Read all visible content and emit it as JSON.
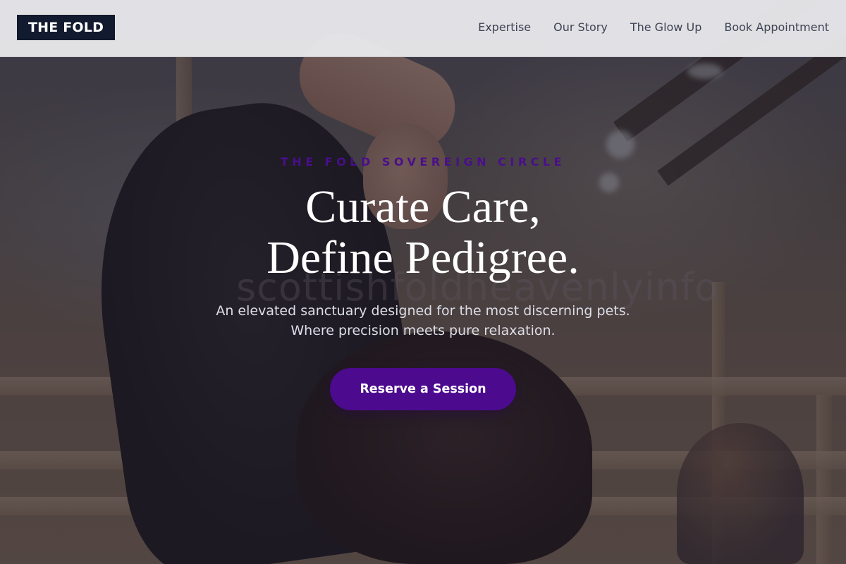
{
  "header": {
    "logo": "THE FOLD",
    "nav": [
      {
        "label": "Expertise"
      },
      {
        "label": "Our Story"
      },
      {
        "label": "The Glow Up"
      },
      {
        "label": "Book Appointment"
      }
    ]
  },
  "hero": {
    "eyebrow": "THE FOLD SOVEREIGN CIRCLE",
    "headline_line1": "Curate Care,",
    "headline_line2": "Define Pedigree.",
    "subhead_line1": "An elevated sanctuary designed for the most discerning pets.",
    "subhead_line2": "Where precision meets pure relaxation.",
    "cta_label": "Reserve a Session",
    "watermark": "scottishfoldheavenlyinfo"
  },
  "colors": {
    "logo_bg": "#111a2e",
    "accent": "#4c0a8e",
    "eyebrow": "#4a0e8c",
    "header_bg": "#e8e8eb"
  }
}
